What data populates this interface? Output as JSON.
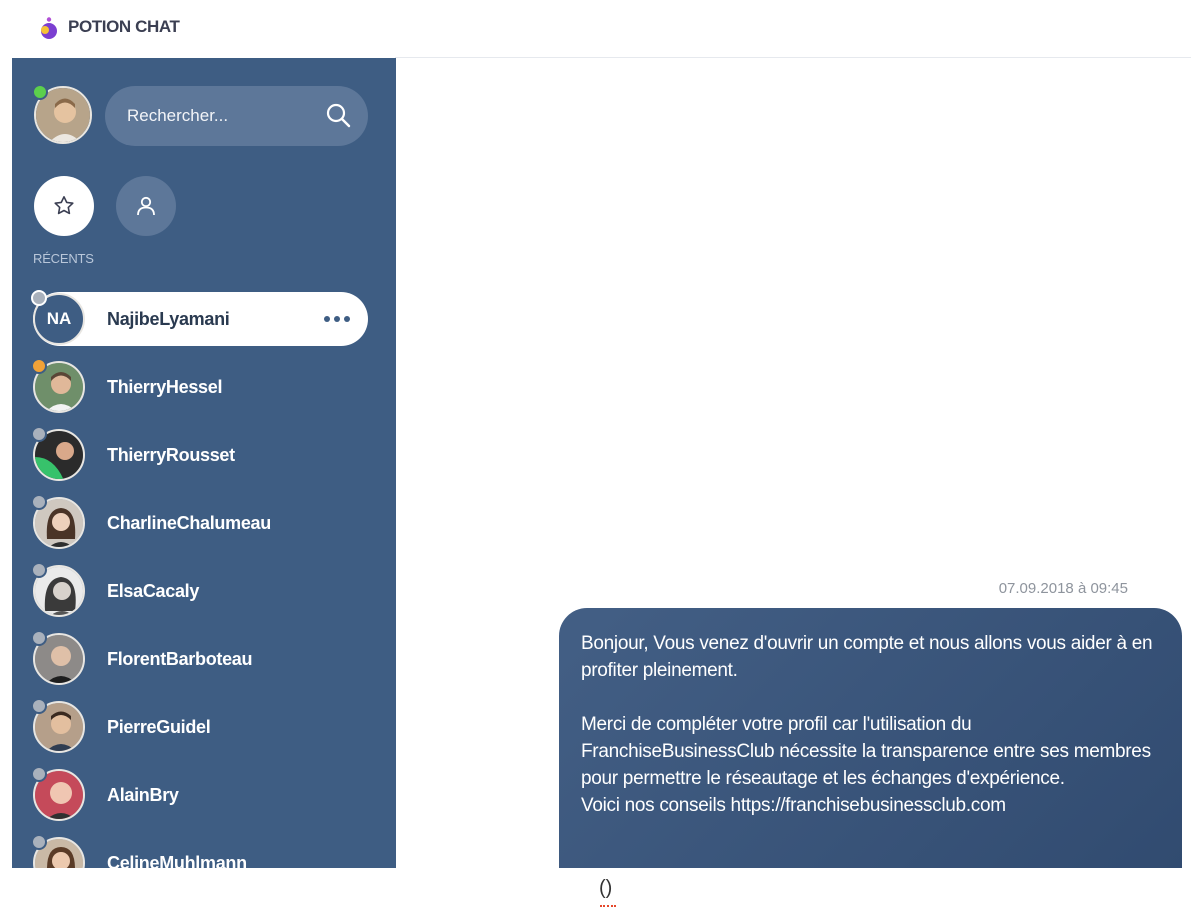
{
  "header": {
    "app_title": "POTION CHAT",
    "logo_icon": "potion-logo-icon"
  },
  "sidebar": {
    "search_placeholder": "Rechercher...",
    "current_user_status": "online",
    "filters": [
      {
        "name": "favorites",
        "icon": "star-icon",
        "active": true
      },
      {
        "name": "contacts",
        "icon": "user-icon",
        "active": false
      }
    ],
    "section_label": "RÉCENTS",
    "contacts": [
      {
        "name": "NajibeLyamani",
        "initials": "NA",
        "status": "offline",
        "active": true
      },
      {
        "name": "ThierryHessel",
        "status": "away"
      },
      {
        "name": "ThierryRousset",
        "status": "offline"
      },
      {
        "name": "CharlineChalumeau",
        "status": "offline"
      },
      {
        "name": "ElsaCacaly",
        "status": "offline"
      },
      {
        "name": "FlorentBarboteau",
        "status": "offline"
      },
      {
        "name": "PierreGuidel",
        "status": "offline"
      },
      {
        "name": "AlainBry",
        "status": "offline"
      },
      {
        "name": "CelineMuhlmann",
        "status": "offline"
      }
    ]
  },
  "chat": {
    "message": {
      "timestamp": "07.09.2018 à 09:45",
      "paragraph1": "Bonjour, Vous venez d'ouvrir un compte et nous allons vous aider à en profiter pleinement.",
      "paragraph2": "Merci de compléter votre profil car l'utilisation du FranchiseBusinessClub nécessite la transparence entre ses membres pour permettre le réseautage et les échanges d'expérience.",
      "paragraph3": "Voici nos conseils https://franchisebusinessclub.com"
    }
  },
  "footer": {
    "text": "()"
  },
  "colors": {
    "sidebar": "#3e5d83",
    "online": "#5ccf4c",
    "away": "#f1a237",
    "offline": "#a9b1bc"
  }
}
